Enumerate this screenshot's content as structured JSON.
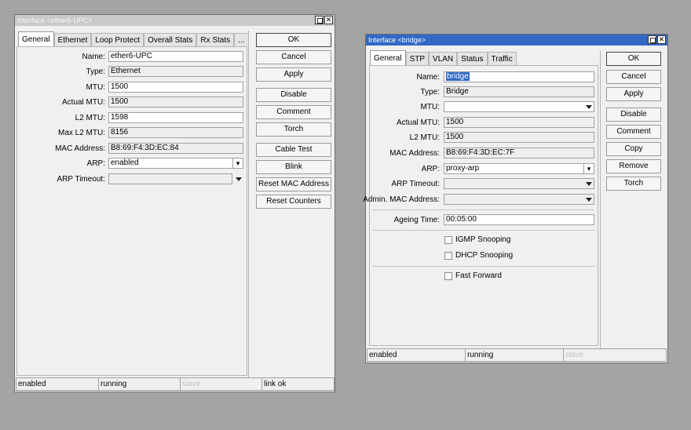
{
  "w1": {
    "title": "Interface <ether6-UPC>",
    "tabs": [
      "General",
      "Ethernet",
      "Loop Protect",
      "Overall Stats",
      "Rx Stats",
      "..."
    ],
    "fields": {
      "name": {
        "label": "Name:",
        "value": "ether6-UPC"
      },
      "type": {
        "label": "Type:",
        "value": "Ethernet"
      },
      "mtu": {
        "label": "MTU:",
        "value": "1500"
      },
      "actual_mtu": {
        "label": "Actual MTU:",
        "value": "1500"
      },
      "l2_mtu": {
        "label": "L2 MTU:",
        "value": "1598"
      },
      "max_l2_mtu": {
        "label": "Max L2 MTU:",
        "value": "8156"
      },
      "mac": {
        "label": "MAC Address:",
        "value": "B8:69:F4:3D:EC:84"
      },
      "arp": {
        "label": "ARP:",
        "value": "enabled"
      },
      "arp_timeout": {
        "label": "ARP Timeout:",
        "value": ""
      }
    },
    "buttons": [
      "OK",
      "Cancel",
      "Apply",
      "Disable",
      "Comment",
      "Torch",
      "Cable Test",
      "Blink",
      "Reset MAC Address",
      "Reset Counters"
    ],
    "status": [
      "enabled",
      "running",
      "slave",
      "link ok"
    ]
  },
  "w2": {
    "title": "Interface <bridge>",
    "tabs": [
      "General",
      "STP",
      "VLAN",
      "Status",
      "Traffic"
    ],
    "fields": {
      "name": {
        "label": "Name:",
        "value": "bridge"
      },
      "type": {
        "label": "Type:",
        "value": "Bridge"
      },
      "mtu": {
        "label": "MTU:",
        "value": ""
      },
      "actual_mtu": {
        "label": "Actual MTU:",
        "value": "1500"
      },
      "l2_mtu": {
        "label": "L2 MTU:",
        "value": "1500"
      },
      "mac": {
        "label": "MAC Address:",
        "value": "B8:69:F4:3D:EC:7F"
      },
      "arp": {
        "label": "ARP:",
        "value": "proxy-arp"
      },
      "arp_timeout": {
        "label": "ARP Timeout:",
        "value": ""
      },
      "admin_mac": {
        "label": "Admin. MAC Address:",
        "value": ""
      },
      "ageing": {
        "label": "Ageing Time:",
        "value": "00:05:00"
      }
    },
    "checkboxes": [
      "IGMP Snooping",
      "DHCP Snooping",
      "Fast Forward"
    ],
    "buttons": [
      "OK",
      "Cancel",
      "Apply",
      "Disable",
      "Comment",
      "Copy",
      "Remove",
      "Torch"
    ],
    "status": [
      "enabled",
      "running",
      "slave"
    ]
  }
}
